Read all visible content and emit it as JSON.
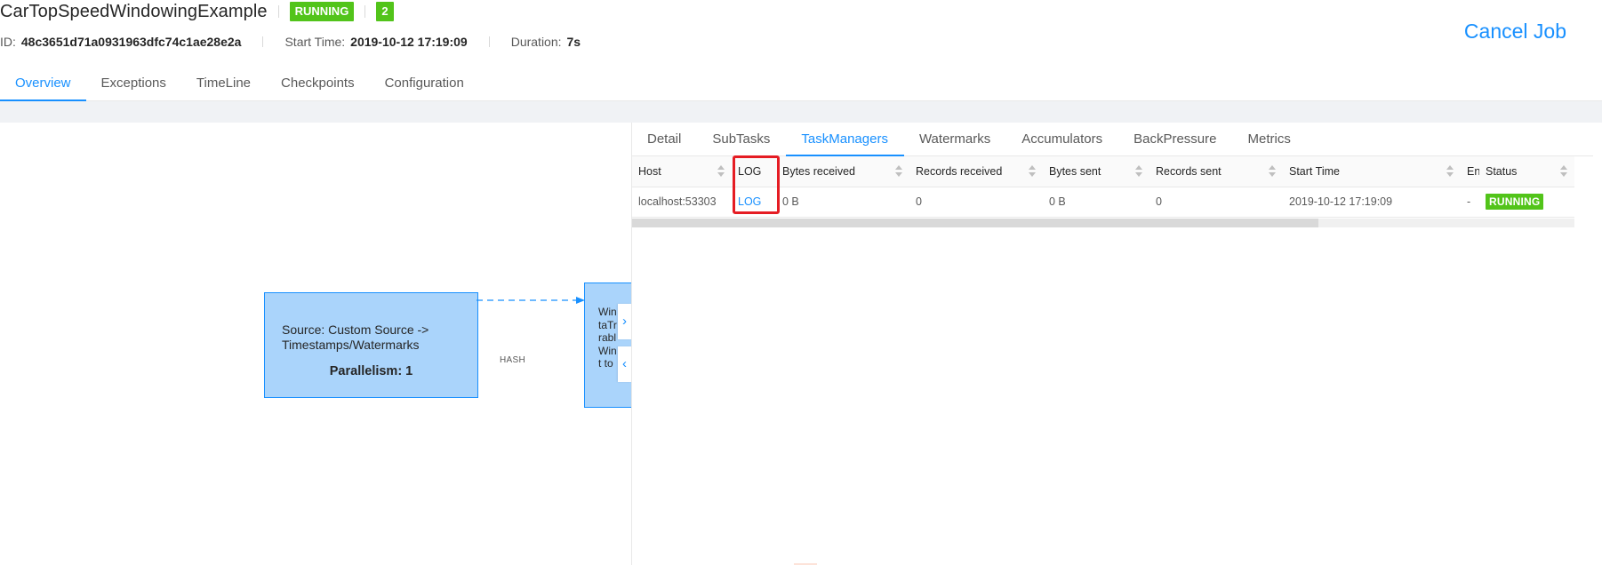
{
  "job": {
    "title": "CarTopSpeedWindowingExample",
    "status": "RUNNING",
    "running_count": "2",
    "id_label": "ID:",
    "id_value": "48c3651d71a0931963dfc74c1ae28e2a",
    "start_time_label": "Start Time:",
    "start_time_value": "2019-10-12 17:19:09",
    "duration_label": "Duration:",
    "duration_value": "7s",
    "cancel_label": "Cancel Job"
  },
  "main_tabs": [
    {
      "label": "Overview",
      "active": true
    },
    {
      "label": "Exceptions"
    },
    {
      "label": "TimeLine"
    },
    {
      "label": "Checkpoints"
    },
    {
      "label": "Configuration"
    }
  ],
  "graph": {
    "source_node": {
      "description": "Source: Custom Source -> Timestamps/Watermarks",
      "parallelism": "Parallelism: 1"
    },
    "window_node": {
      "lines": [
        "Win",
        "taTr",
        "rabl",
        "Win",
        "t to"
      ]
    },
    "edge_label": "HASH"
  },
  "detail_tabs": [
    {
      "label": "Detail"
    },
    {
      "label": "SubTasks"
    },
    {
      "label": "TaskManagers",
      "active": true
    },
    {
      "label": "Watermarks"
    },
    {
      "label": "Accumulators"
    },
    {
      "label": "BackPressure"
    },
    {
      "label": "Metrics"
    }
  ],
  "taskmanagers_table": {
    "headers": [
      "Host",
      "LOG",
      "Bytes received",
      "Records received",
      "Bytes sent",
      "Records sent",
      "Start Time",
      "En",
      "Status"
    ],
    "rows": [
      [
        "localhost:53303",
        "LOG",
        "0 B",
        "0",
        "0 B",
        "0",
        "2019-10-12 17:19:09",
        "-",
        "RUNNING"
      ]
    ]
  },
  "colors": {
    "accent": "#1890ff",
    "running": "#52c41a",
    "highlight": "#e51c23"
  }
}
